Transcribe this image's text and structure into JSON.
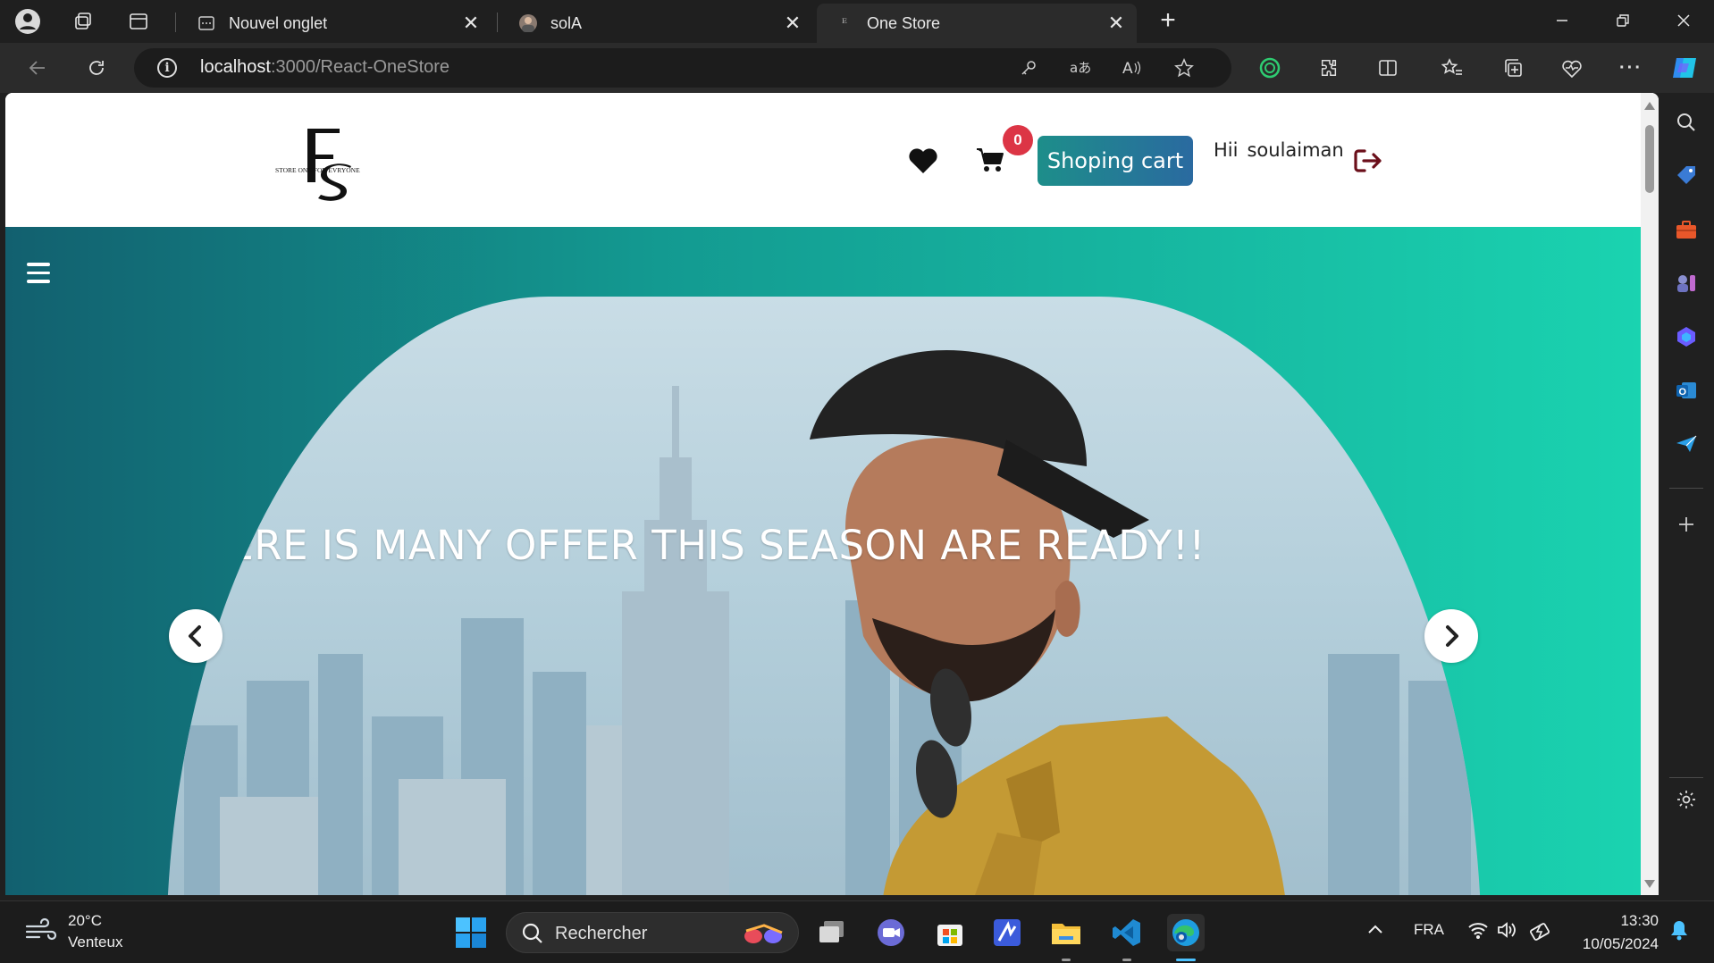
{
  "browser": {
    "tabs": [
      {
        "title": "Nouvel onglet"
      },
      {
        "title": "solA"
      },
      {
        "title": "One Store"
      }
    ],
    "address": {
      "host": "localhost",
      "path": ":3000/React-OneStore"
    }
  },
  "header": {
    "logo_text": "STORE ONE FOR EVRYONE",
    "cart_count": "0",
    "shop_button": "Shoping cart",
    "greeting": "Hii",
    "username": "soulaiman"
  },
  "hero": {
    "tagline": "THERE IS MANY OFFER THIS SEASON ARE READY!!"
  },
  "taskbar": {
    "weather_temp": "20°C",
    "weather_desc": "Venteux",
    "search_label": "Rechercher",
    "language": "FRA",
    "time": "13:30",
    "date": "10/05/2024"
  },
  "colors": {
    "accent_teal": "#1d8e8a",
    "badge_red": "#dc3545",
    "logout_maroon": "#6b0f1a",
    "hero_gradient_start": "#12606f",
    "hero_gradient_end": "#1ad3b0"
  }
}
